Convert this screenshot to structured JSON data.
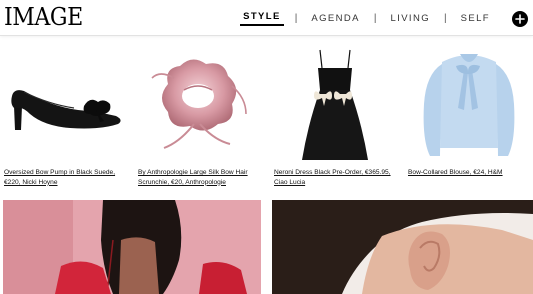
{
  "header": {
    "logo": "IMAGE",
    "nav": [
      {
        "label": "STYLE",
        "active": true
      },
      {
        "label": "AGENDA",
        "active": false
      },
      {
        "label": "LIVING",
        "active": false
      },
      {
        "label": "SELF",
        "active": false
      }
    ],
    "separator": "|",
    "plus_icon": "plus-icon"
  },
  "products": [
    {
      "caption": "Oversized Bow Pump in Black Suede, €220, Nicki Hoyne",
      "image": "black-bow-pump"
    },
    {
      "caption": "By Anthropologie Large Silk Bow Hair Scrunchie, €20, Anthropologie",
      "image": "pink-silk-scrunchie"
    },
    {
      "caption": "Neroni Dress Black Pre-Order, €365.95, Ciao Lucia",
      "image": "black-bow-dress"
    },
    {
      "caption": "Bow-Collared Blouse, €24, H&M",
      "image": "blue-bow-blouse"
    }
  ],
  "features": [
    {
      "image": "woman-pink-top-photo"
    },
    {
      "image": "ear-closeup-photo"
    }
  ],
  "colors": {
    "accent": "#000000",
    "feature_pink": "#e8a9b1",
    "scrunchie_pink": "#c98b95",
    "blouse_blue": "#bcd6ef"
  }
}
